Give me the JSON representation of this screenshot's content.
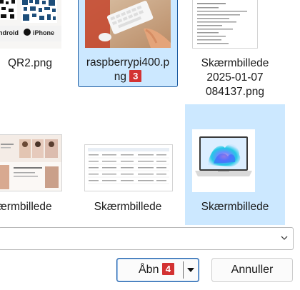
{
  "files": [
    {
      "name": "QR2.png",
      "thumb": "qr-code"
    },
    {
      "name": "raspberrypi400.p",
      "name2": "ng",
      "badge": "3",
      "thumb": "photo-keyboard",
      "selected": true
    },
    {
      "name": "Skærmbillede",
      "name2": "2025-01-07",
      "name3": "084137.png",
      "thumb": "document-list"
    },
    {
      "name": "ærmbillede",
      "thumb": "website-people"
    },
    {
      "name": "Skærmbillede",
      "thumb": "table-document"
    },
    {
      "name": "Skærmbillede",
      "thumb": "laptop-windows",
      "selected": true
    }
  ],
  "qr_labels": {
    "android": "ndroid",
    "iphone": "iPhone"
  },
  "dialog": {
    "filename_value": "",
    "open_label": "Åbn",
    "open_badge": "4",
    "cancel_label": "Annuller"
  }
}
